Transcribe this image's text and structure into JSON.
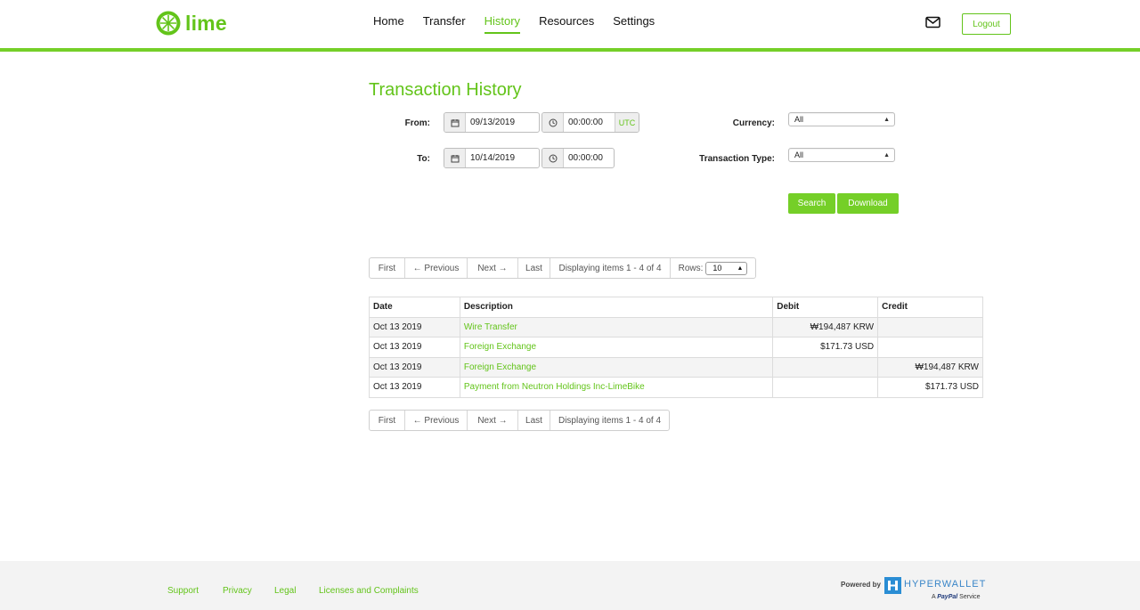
{
  "header": {
    "brand": "lime",
    "nav": [
      "Home",
      "Transfer",
      "History",
      "Resources",
      "Settings"
    ],
    "active_nav": "History",
    "logout_label": "Logout"
  },
  "colors": {
    "accent": "#63c41a",
    "accent_bar": "#75cf28",
    "row_alt": "#f4f4f4"
  },
  "filters": {
    "title": "Transaction History",
    "from_label": "From:",
    "from_date": "09/13/2019",
    "from_time": "00:00:00",
    "utc_label": "UTC",
    "to_label": "To:",
    "to_date": "10/14/2019",
    "to_time": "00:00:00",
    "currency_label": "Currency:",
    "currency_value": "All",
    "type_label": "Transaction Type:",
    "type_value": "All",
    "search_label": "Search",
    "download_label": "Download",
    "icons": {
      "date": "calendar-icon",
      "time": "clock-icon"
    }
  },
  "pager": {
    "first": "First",
    "previous": "← Previous",
    "next": "Next →",
    "last": "Last",
    "displaying": "Displaying items 1 - 4 of 4",
    "rows_label": "Rows:",
    "rows_value": "10"
  },
  "table": {
    "headers": {
      "date": "Date",
      "description": "Description",
      "debit": "Debit",
      "credit": "Credit"
    },
    "rows": [
      {
        "date": "Oct 13 2019",
        "description": "Wire Transfer",
        "debit": "₩194,487 KRW",
        "credit": ""
      },
      {
        "date": "Oct 13 2019",
        "description": "Foreign Exchange",
        "debit": "$171.73 USD",
        "credit": ""
      },
      {
        "date": "Oct 13 2019",
        "description": "Foreign Exchange",
        "debit": "",
        "credit": "₩194,487 KRW"
      },
      {
        "date": "Oct 13 2019",
        "description": "Payment from Neutron Holdings Inc-LimeBike",
        "debit": "",
        "credit": "$171.73 USD"
      }
    ]
  },
  "footer": {
    "links": [
      "Support",
      "Privacy",
      "Legal",
      "Licenses and Complaints"
    ],
    "powered_by": "Powered by",
    "brand": "HYPERWALLET",
    "paypal_prefix": "A",
    "paypal_name": "PayPal",
    "paypal_suffix": "Service"
  }
}
